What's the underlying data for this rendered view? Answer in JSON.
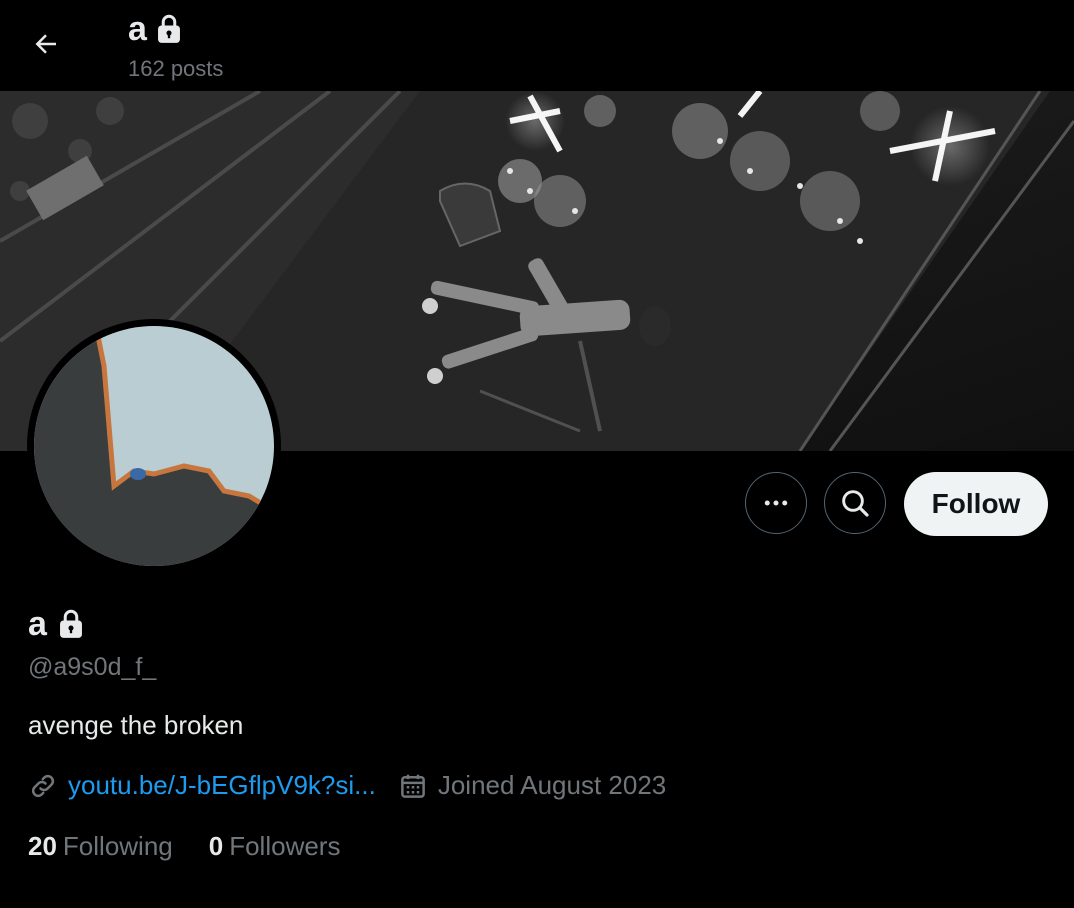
{
  "header": {
    "title": "a",
    "post_count": "162 posts"
  },
  "profile": {
    "name": "a",
    "handle": "@a9s0d_f_",
    "bio": "avenge the broken",
    "link": "youtu.be/J-bEGflpV9k?si...",
    "joined": "Joined August 2023",
    "following_count": "20",
    "following_label": "Following",
    "followers_count": "0",
    "followers_label": "Followers"
  },
  "actions": {
    "follow_label": "Follow"
  },
  "icons": {
    "back": "arrow-left-icon",
    "lock": "lock-icon",
    "more": "more-dots-icon",
    "search": "search-icon",
    "link": "link-icon",
    "calendar": "calendar-icon"
  },
  "colors": {
    "background": "#000000",
    "text_primary": "#e7e9ea",
    "text_secondary": "#71767b",
    "link": "#1d9bf0",
    "follow_bg": "#eff3f4"
  }
}
